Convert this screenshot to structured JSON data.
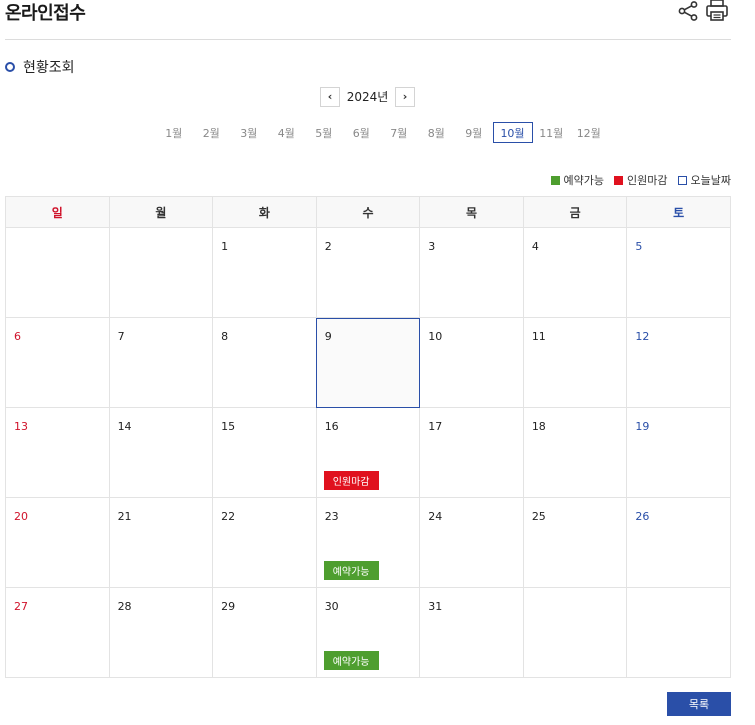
{
  "header": {
    "title": "온라인접수",
    "share_icon": "share-icon",
    "print_icon": "print-icon"
  },
  "section": {
    "title": "현황조회"
  },
  "year_nav": {
    "prev": "‹",
    "year": "2024년",
    "next": "›"
  },
  "months": [
    "1월",
    "2월",
    "3월",
    "4월",
    "5월",
    "6월",
    "7월",
    "8월",
    "9월",
    "10월",
    "11월",
    "12월"
  ],
  "active_month": "10월",
  "legend": [
    {
      "label": "예약가능",
      "color": "#4e9e2f"
    },
    {
      "label": "인원마감",
      "color": "#e0111e"
    },
    {
      "label": "오늘날짜",
      "color": "#2a4fa8"
    }
  ],
  "weekdays": [
    "일",
    "월",
    "화",
    "수",
    "목",
    "금",
    "토"
  ],
  "weeks": [
    [
      {
        "day": ""
      },
      {
        "day": ""
      },
      {
        "day": "1"
      },
      {
        "day": "2"
      },
      {
        "day": "3"
      },
      {
        "day": "4"
      },
      {
        "day": "5"
      }
    ],
    [
      {
        "day": "6"
      },
      {
        "day": "7"
      },
      {
        "day": "8"
      },
      {
        "day": "9",
        "today": true
      },
      {
        "day": "10"
      },
      {
        "day": "11"
      },
      {
        "day": "12"
      }
    ],
    [
      {
        "day": "13"
      },
      {
        "day": "14"
      },
      {
        "day": "15"
      },
      {
        "day": "16",
        "badge": "인원마감",
        "status": "closed"
      },
      {
        "day": "17"
      },
      {
        "day": "18"
      },
      {
        "day": "19"
      }
    ],
    [
      {
        "day": "20"
      },
      {
        "day": "21"
      },
      {
        "day": "22"
      },
      {
        "day": "23",
        "badge": "예약가능",
        "status": "available"
      },
      {
        "day": "24"
      },
      {
        "day": "25"
      },
      {
        "day": "26"
      }
    ],
    [
      {
        "day": "27"
      },
      {
        "day": "28"
      },
      {
        "day": "29"
      },
      {
        "day": "30",
        "badge": "예약가능",
        "status": "available"
      },
      {
        "day": "31"
      },
      {
        "day": ""
      },
      {
        "day": ""
      }
    ]
  ],
  "list_button": "목록"
}
